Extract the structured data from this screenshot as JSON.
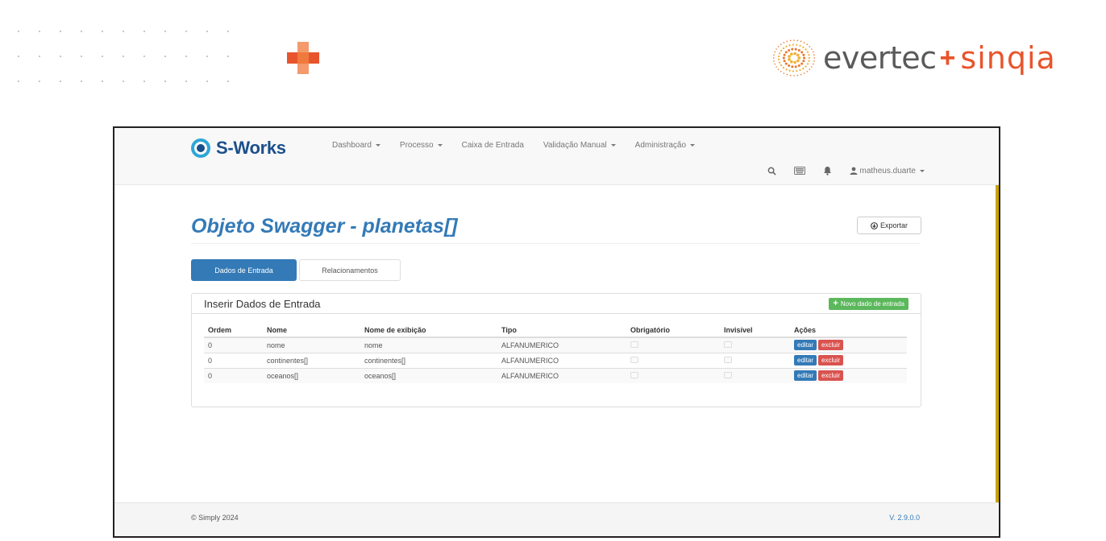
{
  "slide": {
    "brand_evertec": "evertec",
    "brand_plus": "+",
    "brand_sinqia": "sinqia"
  },
  "app": {
    "logo_text": "S-Works",
    "menu": [
      {
        "label": "Dashboard",
        "dropdown": true
      },
      {
        "label": "Processo",
        "dropdown": true
      },
      {
        "label": "Caixa de Entrada",
        "dropdown": false
      },
      {
        "label": "Validação Manual",
        "dropdown": true
      },
      {
        "label": "Administração",
        "dropdown": true
      }
    ],
    "user": "matheus.duarte",
    "icons": [
      "search-icon",
      "keyboard-icon",
      "bell-icon",
      "user-icon"
    ]
  },
  "page": {
    "title": "Objeto Swagger - planetas[]",
    "export_label": "Exportar",
    "tabs": [
      {
        "label": "Dados de Entrada",
        "active": true
      },
      {
        "label": "Relacionamentos",
        "active": false
      }
    ]
  },
  "panel": {
    "title": "Inserir Dados de Entrada",
    "new_button": "Novo dado de entrada",
    "columns": [
      "Ordem",
      "Nome",
      "Nome de exibição",
      "Tipo",
      "Obrigatório",
      "Invisível",
      "Ações"
    ],
    "rows": [
      {
        "ordem": "0",
        "nome": "nome",
        "exibicao": "nome",
        "tipo": "ALFANUMERICO",
        "obrigatorio": false,
        "invisivel": false
      },
      {
        "ordem": "0",
        "nome": "continentes[]",
        "exibicao": "continentes[]",
        "tipo": "ALFANUMERICO",
        "obrigatorio": false,
        "invisivel": false
      },
      {
        "ordem": "0",
        "nome": "oceanos[]",
        "exibicao": "oceanos[]",
        "tipo": "ALFANUMERICO",
        "obrigatorio": false,
        "invisivel": false
      }
    ],
    "edit_label": "editar",
    "delete_label": "excluir"
  },
  "footer": {
    "copyright": "© Simply 2024",
    "version": "V. 2.9.0.0"
  },
  "colors": {
    "primary": "#337ab7",
    "success": "#5cb85c",
    "danger": "#d9534f",
    "accent_orange": "#e8552c"
  }
}
